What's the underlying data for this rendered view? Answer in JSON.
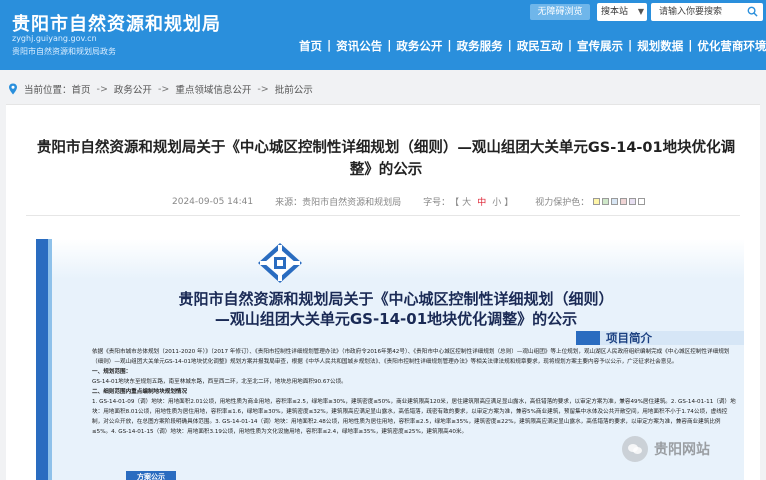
{
  "header": {
    "site_title": "贵阳市自然资源和规划局",
    "site_domain": "zyghj.guiyang.gov.cn",
    "site_subtitle": "贵阳市自然资源和规划局政务",
    "accessible_label": "无障碍浏览",
    "search_scope": "搜本站",
    "search_placeholder": "请输入你要搜索",
    "accent_color": "#2a8fdc"
  },
  "nav": {
    "items": [
      "首页",
      "资讯公告",
      "政务公开",
      "政务服务",
      "政民互动",
      "宣传展示",
      "规划数据",
      "优化营商环境"
    ]
  },
  "breadcrumb": {
    "label": "当前位置：",
    "items": [
      "首页",
      "政务公开",
      "重点领域信息公开",
      "批前公示"
    ]
  },
  "article": {
    "title": "贵阳市自然资源和规划局关于《中心城区控制性详细规划（细则）—观山组团大关单元GS-14-01地块优化调整》的公示",
    "date": "2024-09-05 14:41",
    "source_label": "来源：",
    "source": "贵阳市自然资源和规划局",
    "font_label": "字号：",
    "font_open": "【",
    "font_large": "大",
    "font_medium": "中",
    "font_small": "小",
    "font_close": "】",
    "eye_label": "视力保护色："
  },
  "poster": {
    "title_line1": "贵阳市自然资源和规划局关于《中心城区控制性详细规划（细则）",
    "title_line2": "—观山组团大关单元GS-14-01地块优化调整》的公示",
    "intro_banner": "项目简介",
    "para1": "依据《贵阳市城市总体规划（2011-2020 年）》（2017 年修订）、《贵阳市控制性详细规划管理办法》（市政府令2016年第42号）、《贵阳市中心城区控制性详细规划（总则）—观山组团》等上位规划，观山湖区人民政府组织编制完成《中心城区控制性详细规划（细则）—观山组团大关单元GS-14-01地块优化调整》规划方案并报我局审查，根据《中华人民共和国城乡规划法》、《贵阳市控制性详细规划管理办法》等相关法律法规和规章要求，现将规划方案主要内容予以公示，广泛征求社会意见。",
    "h1": "一、规划范围：",
    "para2": "GS-14-01地块东至规划五路，南至林城东路，西至西二环，北至北二环，地块总用地面积90.67公顷。",
    "h2": "二、细则范围内重点编制地块规划情况",
    "para3": "1. GS-14-01-09（调）地块：用地面积2.01公顷，用地性质为商业用地，容积率≤2.5，绿地率≥30%，建筑密度≤50%，商业建筑限高120米，居住建筑限高应满足显山露水，高低错落的要求，以审定方案为准，兼容49%居住建筑。2. GS-14-01-11（调）地块：用地面积8.01公顷，用地性质为居住用地，容积率≤1.6，绿地率≥30%，建筑密度≤32%，建筑限高应满足显山露水，高低错落，疏密有致的要求，以审定方案为准，兼容5%商业建筑，预留集中水体及公共开敞空间，用地面积不小于1.74公顷，虚线控制，对公众开放，在总图方案阶段明确具体范围。3. GS-14-01-14（调）地块：用地面积2.48公顷，用地性质为居住用地，容积率≤2.5，绿地率≥35%，建筑密度≤22%，建筑限高应满足显山露水，高低错落的要求，以审定方案为准，兼容商业建筑比例≤5%。4. GS-14-01-15（调）地块：用地面积3.19公顷，用地性质为文化设施用地，容积率≤2.4，绿地率≥35%，建筑密度≤25%，建筑限高40米。",
    "bottom_tab": "方案公示",
    "bar_color": "#2a6cc0"
  },
  "eye_colors": [
    "#fff6a8",
    "#cfe8c9",
    "#d8e6f4",
    "#f0d5d5",
    "#e8e0f2",
    "#ffffff"
  ],
  "watermark": {
    "text": "贵阳网站"
  }
}
